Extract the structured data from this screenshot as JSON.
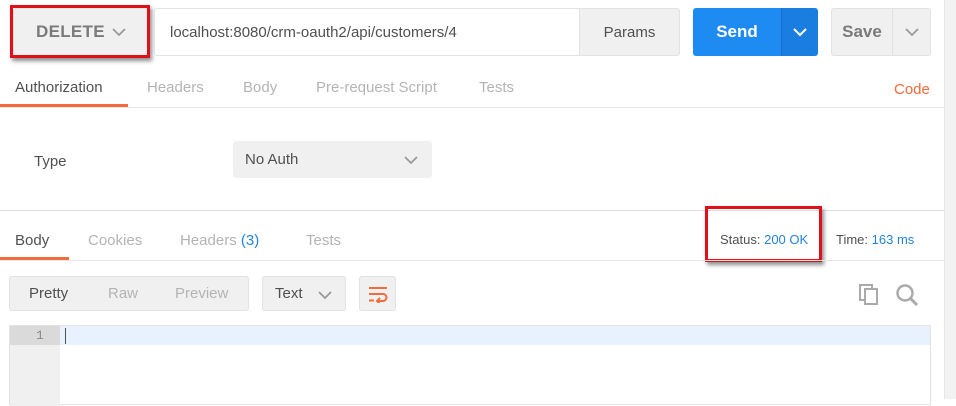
{
  "request": {
    "method": "DELETE",
    "url": "localhost:8080/crm-oauth2/api/customers/4",
    "params_label": "Params",
    "send_label": "Send",
    "save_label": "Save"
  },
  "request_tabs": [
    "Authorization",
    "Headers",
    "Body",
    "Pre-request Script",
    "Tests"
  ],
  "code_link": "Code",
  "auth": {
    "type_label": "Type",
    "type_value": "No Auth"
  },
  "response_tabs": {
    "body": "Body",
    "cookies": "Cookies",
    "headers": "Headers",
    "headers_count": "(3)",
    "tests": "Tests"
  },
  "status": {
    "label": "Status:",
    "value": "200 OK"
  },
  "time": {
    "label": "Time:",
    "value": "163 ms"
  },
  "view_modes": [
    "Pretty",
    "Raw",
    "Preview"
  ],
  "format": "Text",
  "editor": {
    "line_number": "1"
  },
  "colors": {
    "accent_orange": "#f26b3a",
    "send_blue": "#1d8bf1",
    "link_blue": "#2583d6",
    "highlight_red": "#e0101a"
  }
}
